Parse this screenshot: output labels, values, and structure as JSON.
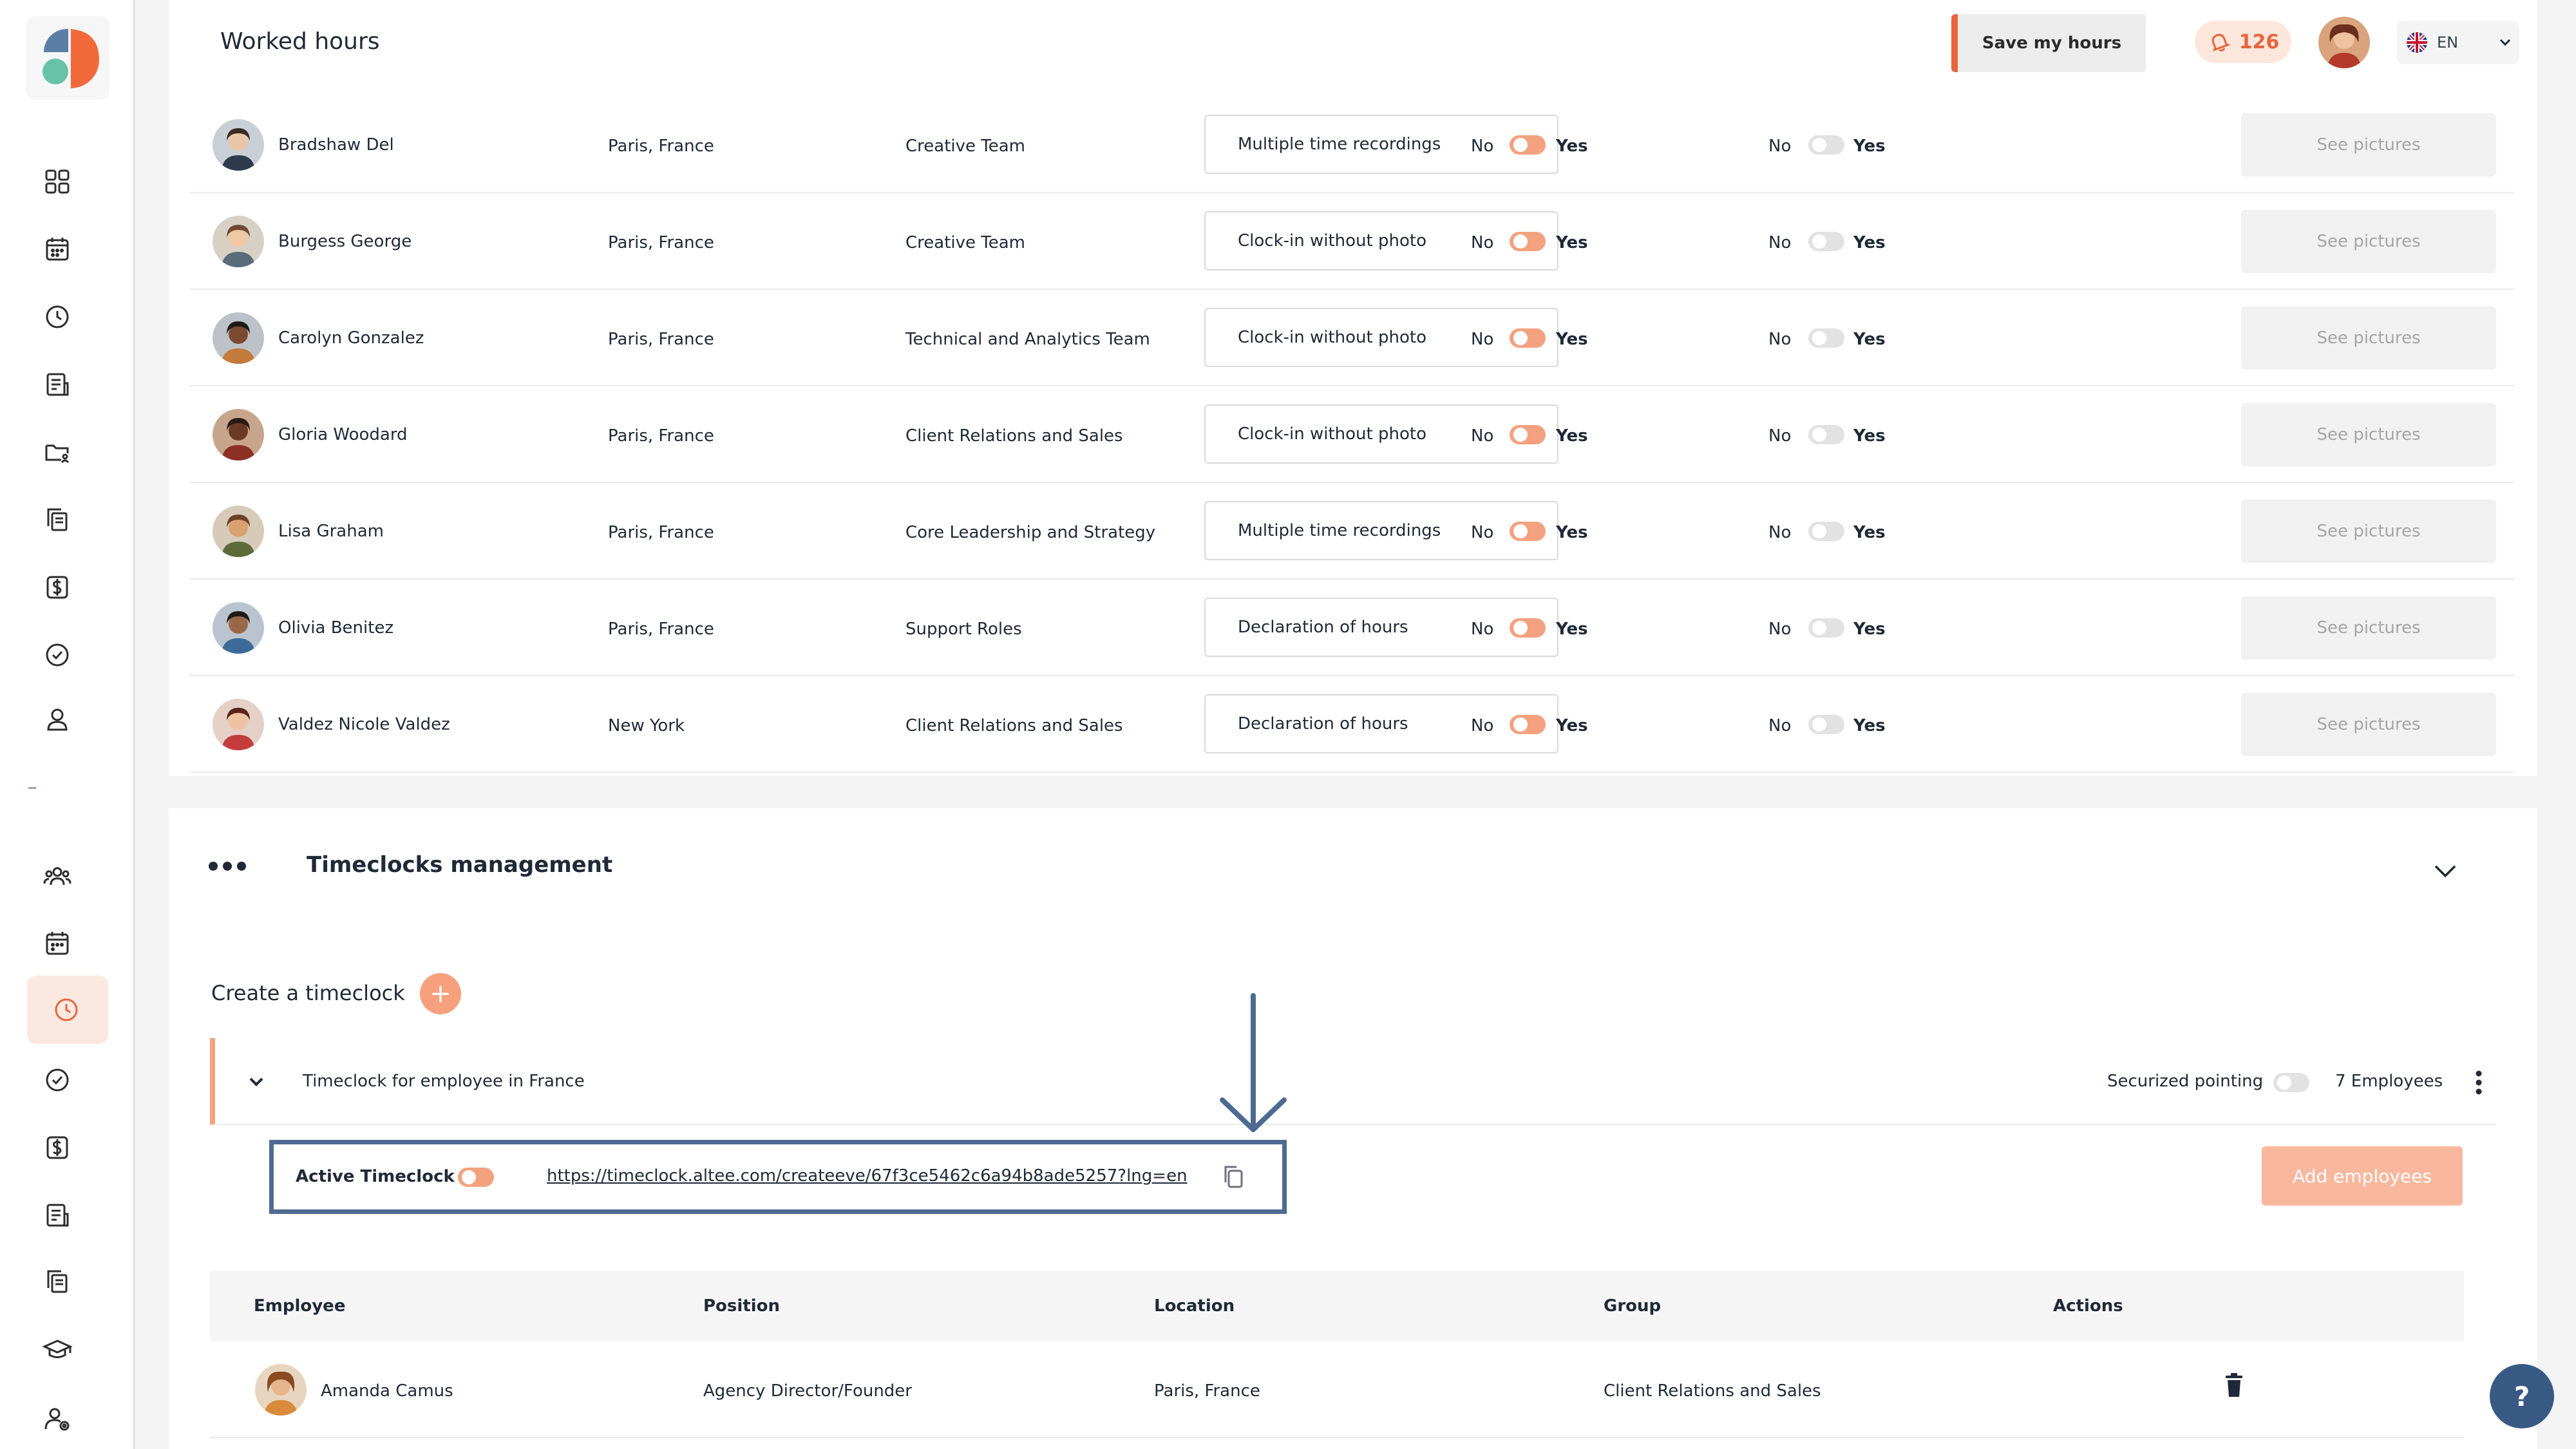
{
  "header": {
    "title": "Worked hours",
    "save_label": "Save my hours",
    "notification_count": "126",
    "language": "EN"
  },
  "colors": {
    "accent": "#e8643d",
    "accent_light": "#f4a17f",
    "highlight_box": "#4d6a91"
  },
  "employees": [
    {
      "name": "Bradshaw Del",
      "location": "Paris, France",
      "team": "Creative Team",
      "mode": "Multiple time recordings",
      "toggle1_no": "No",
      "toggle1_yes": "Yes",
      "toggle2_no": "No",
      "toggle2_yes": "Yes",
      "pictures": "See pictures"
    },
    {
      "name": "Burgess George",
      "location": "Paris, France",
      "team": "Creative Team",
      "mode": "Clock-in without photo",
      "toggle1_no": "No",
      "toggle1_yes": "Yes",
      "toggle2_no": "No",
      "toggle2_yes": "Yes",
      "pictures": "See pictures"
    },
    {
      "name": "Carolyn Gonzalez",
      "location": "Paris, France",
      "team": "Technical and Analytics Team",
      "mode": "Clock-in without photo",
      "toggle1_no": "No",
      "toggle1_yes": "Yes",
      "toggle2_no": "No",
      "toggle2_yes": "Yes",
      "pictures": "See pictures"
    },
    {
      "name": "Gloria Woodard",
      "location": "Paris, France",
      "team": "Client Relations and Sales",
      "mode": "Clock-in without photo",
      "toggle1_no": "No",
      "toggle1_yes": "Yes",
      "toggle2_no": "No",
      "toggle2_yes": "Yes",
      "pictures": "See pictures"
    },
    {
      "name": "Lisa Graham",
      "location": "Paris, France",
      "team": "Core Leadership and Strategy",
      "mode": "Multiple time recordings",
      "toggle1_no": "No",
      "toggle1_yes": "Yes",
      "toggle2_no": "No",
      "toggle2_yes": "Yes",
      "pictures": "See pictures"
    },
    {
      "name": "Olivia Benitez",
      "location": "Paris, France",
      "team": "Support Roles",
      "mode": "Declaration of hours",
      "toggle1_no": "No",
      "toggle1_yes": "Yes",
      "toggle2_no": "No",
      "toggle2_yes": "Yes",
      "pictures": "See pictures"
    },
    {
      "name": "Valdez Nicole Valdez",
      "location": "New York",
      "team": "Client Relations and Sales",
      "mode": "Declaration of hours",
      "toggle1_no": "No",
      "toggle1_yes": "Yes",
      "toggle2_no": "No",
      "toggle2_yes": "Yes",
      "pictures": "See pictures"
    }
  ],
  "timeclocks": {
    "section_title": "Timeclocks management",
    "create_label": "Create a timeclock",
    "create_icon": "+",
    "item": {
      "name": "Timeclock for employee in France",
      "secured_label": "Securized pointing",
      "employee_count": "7 Employees"
    },
    "active": {
      "label": "Active Timeclock",
      "url": "https://timeclock.altee.com/createeve/67f3ce5462c6a94b8ade5257?lng=en"
    },
    "add_employees_label": "Add employees",
    "columns": [
      "Employee",
      "Position",
      "Location",
      "Group",
      "Actions"
    ],
    "rows": [
      {
        "employee": "Amanda Camus",
        "position": "Agency Director/Founder",
        "location": "Paris, France",
        "group": "Client Relations and Sales"
      }
    ]
  },
  "help_label": "?"
}
